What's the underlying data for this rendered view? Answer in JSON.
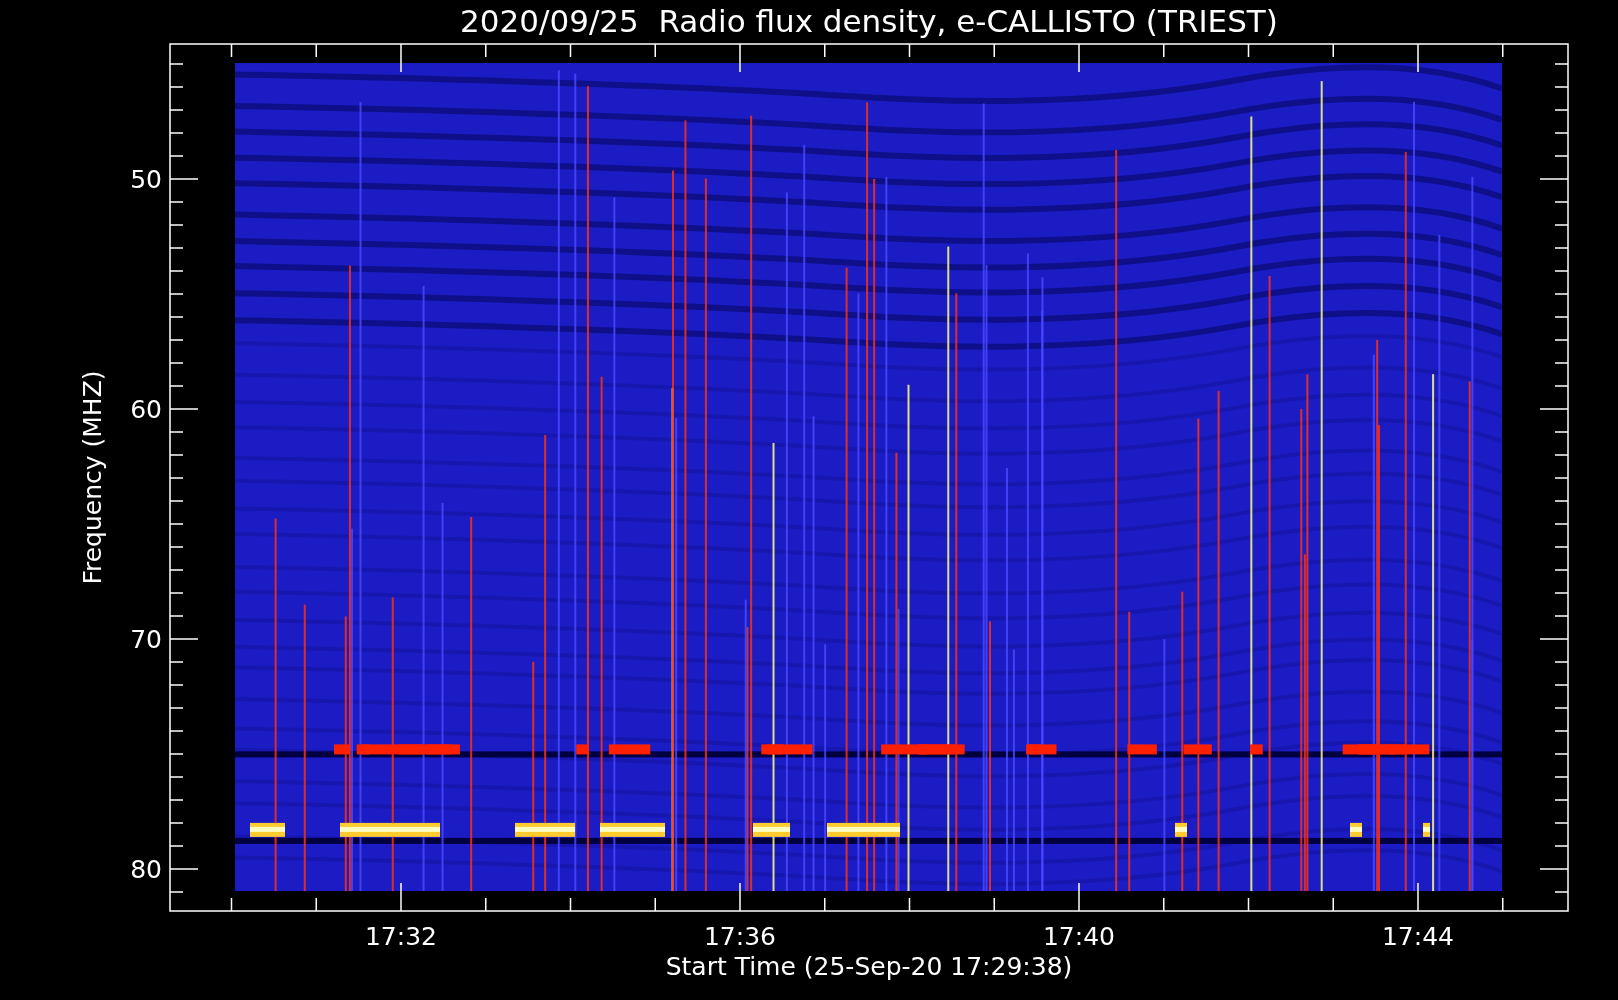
{
  "title": "2020/09/25  Radio flux density, e-CALLISTO (TRIEST)",
  "y_axis": {
    "label": "Frequency (MHZ)",
    "ticks": [
      "50",
      "60",
      "70",
      "80"
    ]
  },
  "x_axis": {
    "label": "Start Time (25-Sep-20 17:29:38)",
    "ticks": [
      "17:32",
      "17:36",
      "17:40",
      "17:44"
    ]
  }
}
